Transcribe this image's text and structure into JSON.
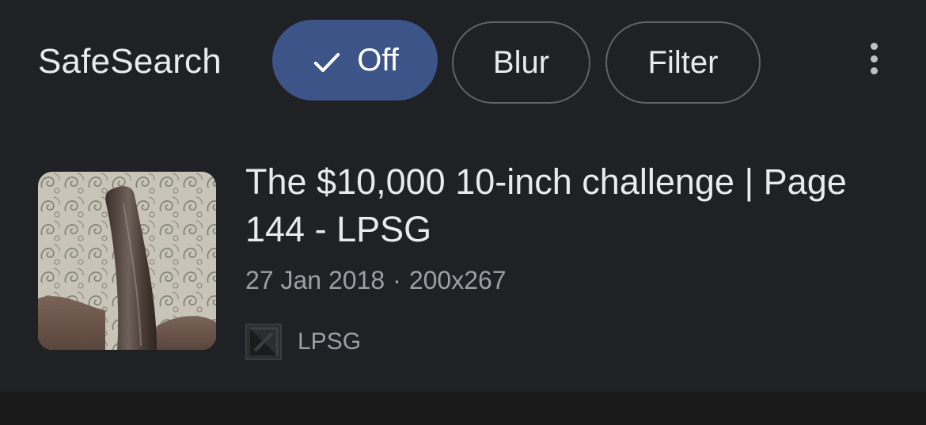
{
  "safesearch": {
    "label": "SafeSearch",
    "options": [
      {
        "label": "Off",
        "selected": true
      },
      {
        "label": "Blur",
        "selected": false
      },
      {
        "label": "Filter",
        "selected": false
      }
    ],
    "more_icon": "more-vert-icon"
  },
  "result": {
    "title": "The $10,000 10-inch challenge | Page 144 - LPSG",
    "date": "27 Jan 2018",
    "separator": "·",
    "dimensions": "200x267",
    "source_name": "LPSG",
    "source_icon": "site-favicon"
  },
  "colors": {
    "background": "#202124",
    "selected_chip": "#3c5488",
    "chip_border": "#5f6368",
    "text_primary": "#e8eaed",
    "text_secondary": "#9aa0a6"
  }
}
